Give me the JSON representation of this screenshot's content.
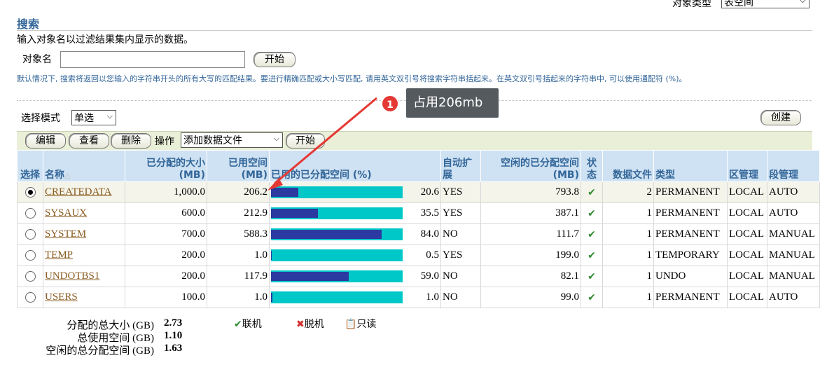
{
  "header": {
    "objtype_label": "对象类型",
    "objtype_value": "表空间"
  },
  "search": {
    "title": "搜索",
    "instruction": "输入对象名以过滤结果集内显示的数据。",
    "objname_label": "对象名",
    "objname_value": "",
    "go_label": "开始",
    "hint": "默认情况下, 搜索将返回以您输入的字符串开头的所有大写的匹配结果。要进行精确匹配或大小写匹配, 请用英文双引号将搜索字符串括起来。在英文双引号括起来的字符串中, 可以使用通配符 (%)。"
  },
  "selection": {
    "mode_label": "选择模式",
    "mode_value": "单选",
    "create_label": "创建"
  },
  "toolbar": {
    "edit_label": "编辑",
    "view_label": "查看",
    "delete_label": "删除",
    "op_label": "操作",
    "op_value": "添加数据文件",
    "go_label": "开始"
  },
  "table": {
    "headers": {
      "select": "选择",
      "name": "名称",
      "alloc_size": "已分配的大小 (MB)",
      "used": "已用空间 (MB)",
      "used_pct": "已用的已分配空间 (%)",
      "autoext": "自动扩展",
      "free": "空闲的已分配空间 (MB)",
      "status": "状态",
      "datafiles": "数据文件",
      "type": "类型",
      "extent_mgmt": "区管理",
      "segment_mgmt": "段管理"
    },
    "rows": [
      {
        "selected": true,
        "name": "CREATEDATA",
        "alloc": "1,000.0",
        "used": "206.2",
        "pct": 20.6,
        "pct_text": "20.6",
        "autoext": "YES",
        "free": "793.8",
        "files": "2",
        "type": "PERMANENT",
        "extent": "LOCAL",
        "segment": "AUTO"
      },
      {
        "selected": false,
        "name": "SYSAUX",
        "alloc": "600.0",
        "used": "212.9",
        "pct": 35.5,
        "pct_text": "35.5",
        "autoext": "YES",
        "free": "387.1",
        "files": "1",
        "type": "PERMANENT",
        "extent": "LOCAL",
        "segment": "AUTO"
      },
      {
        "selected": false,
        "name": "SYSTEM",
        "alloc": "700.0",
        "used": "588.3",
        "pct": 84.0,
        "pct_text": "84.0",
        "autoext": "NO",
        "free": "111.7",
        "files": "1",
        "type": "PERMANENT",
        "extent": "LOCAL",
        "segment": "MANUAL"
      },
      {
        "selected": false,
        "name": "TEMP",
        "alloc": "200.0",
        "used": "1.0",
        "pct": 0.5,
        "pct_text": "0.5",
        "autoext": "YES",
        "free": "199.0",
        "files": "1",
        "type": "TEMPORARY",
        "extent": "LOCAL",
        "segment": "MANUAL"
      },
      {
        "selected": false,
        "name": "UNDOTBS1",
        "alloc": "200.0",
        "used": "117.9",
        "pct": 59.0,
        "pct_text": "59.0",
        "autoext": "NO",
        "free": "82.1",
        "files": "1",
        "type": "UNDO",
        "extent": "LOCAL",
        "segment": "MANUAL"
      },
      {
        "selected": false,
        "name": "USERS",
        "alloc": "100.0",
        "used": "1.0",
        "pct": 1.0,
        "pct_text": "1.0",
        "autoext": "NO",
        "free": "99.0",
        "files": "1",
        "type": "PERMANENT",
        "extent": "LOCAL",
        "segment": "AUTO"
      }
    ]
  },
  "totals": {
    "alloc_label": "分配的总大小 (GB)",
    "alloc_value": "2.73",
    "used_label": "总使用空间 (GB)",
    "used_value": "1.10",
    "free_label": "空闲的总分配空间 (GB)",
    "free_value": "1.63"
  },
  "legend": {
    "online": "联机",
    "offline": "脱机",
    "readonly": "只读"
  },
  "annotation": {
    "number": "1",
    "text": "占用206mb"
  },
  "colors": {
    "bar_bg": "#00c8c8",
    "bar_fill": "#2b3aa0",
    "header_bg": "#cfe2f3",
    "annotation_red": "#e53935"
  }
}
